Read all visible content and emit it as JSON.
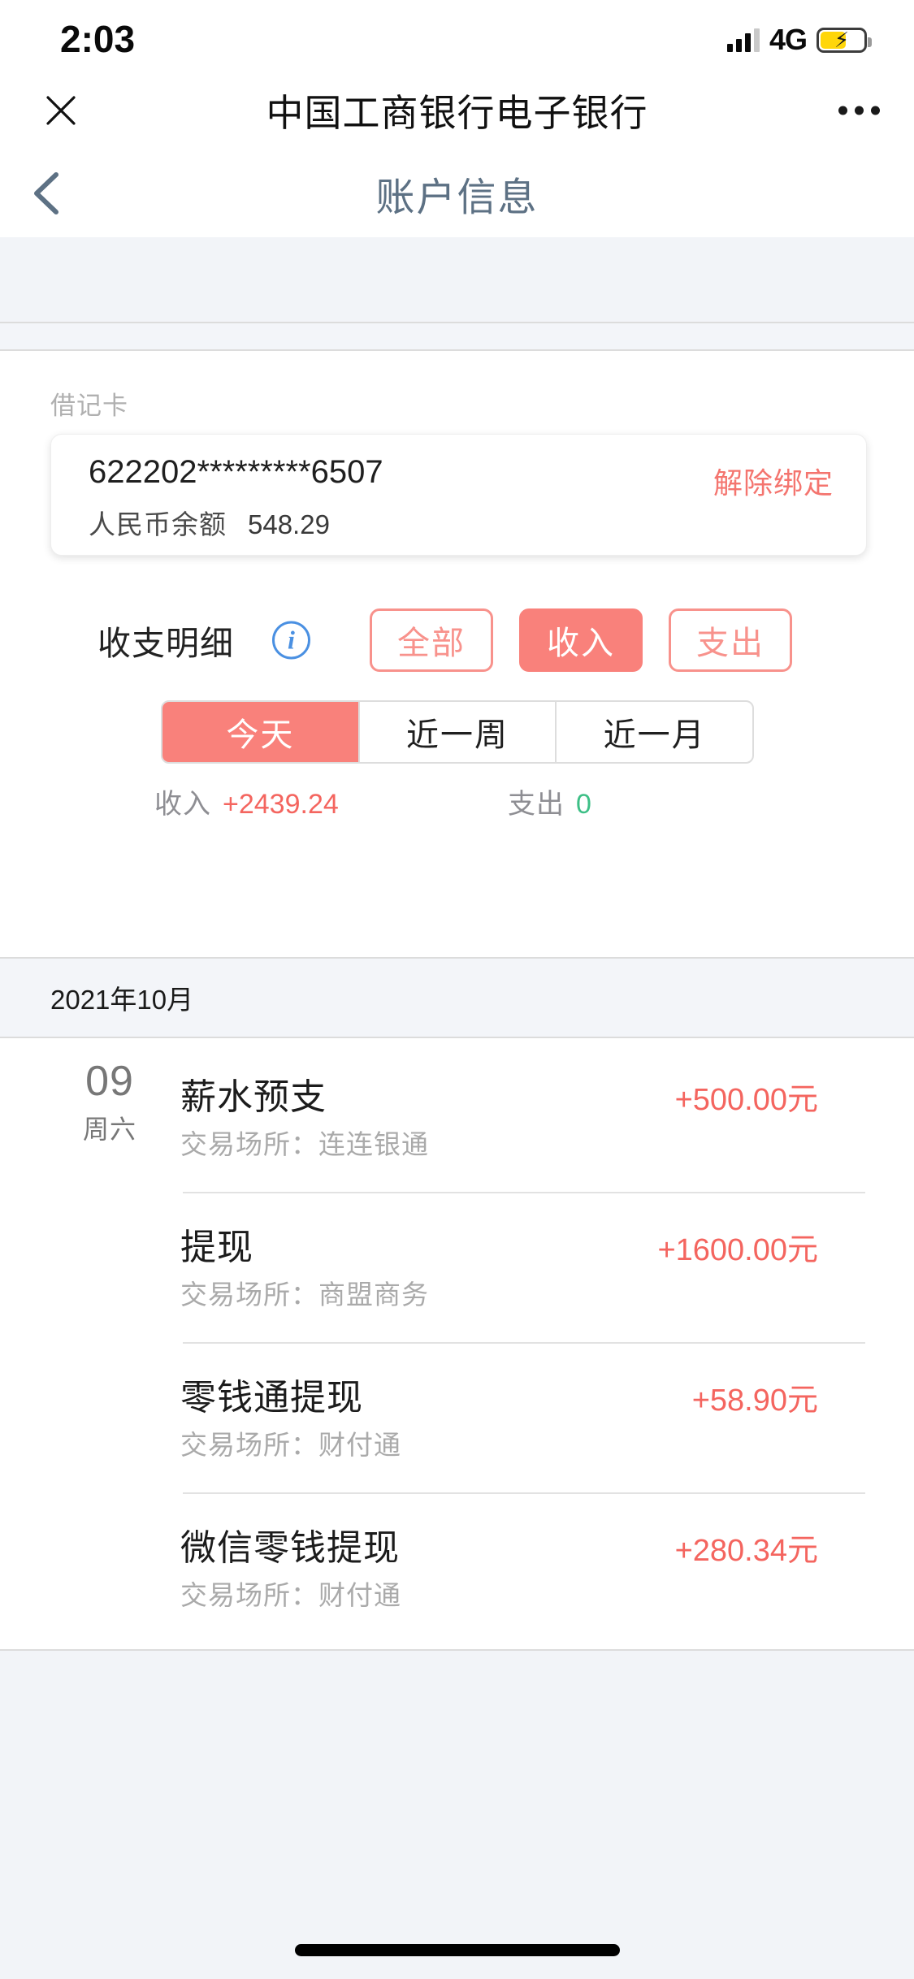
{
  "status_bar": {
    "time": "2:03",
    "network": "4G",
    "signal_icon": "signal-bars-icon",
    "battery_icon": "battery-charging-icon"
  },
  "nav": {
    "close_icon": "close-icon",
    "title": "中国工商银行电子银行",
    "more_icon": "more-horizontal-icon"
  },
  "page_header": {
    "back_icon": "chevron-left-icon",
    "title": "账户信息"
  },
  "account": {
    "section_label": "借记卡",
    "card_number": "622202*********6507",
    "balance_label": "人民币余额",
    "balance_value": "548.29",
    "unbind_label": "解除绑定"
  },
  "filters": {
    "label": "收支明细",
    "info_icon": "info-circle-icon",
    "info_glyph": "i",
    "chips": [
      {
        "label": "全部",
        "active": false
      },
      {
        "label": "收入",
        "active": true
      },
      {
        "label": "支出",
        "active": false
      }
    ]
  },
  "period_tabs": [
    {
      "label": "今天",
      "active": true
    },
    {
      "label": "近一周",
      "active": false
    },
    {
      "label": "近一月",
      "active": false
    }
  ],
  "summary": {
    "income_label": "收入",
    "income_value": "+2439.24",
    "expense_label": "支出",
    "expense_value": "0"
  },
  "month_group": {
    "header": "2021年10月"
  },
  "transactions": [
    {
      "day": "09",
      "weekday": "周六",
      "title": "薪水预支",
      "place": "交易场所：连连银通",
      "amount": "+500.00元"
    },
    {
      "day": "",
      "weekday": "",
      "title": "提现",
      "place": "交易场所：商盟商务",
      "amount": "+1600.00元"
    },
    {
      "day": "",
      "weekday": "",
      "title": "零钱通提现",
      "place": "交易场所：财付通",
      "amount": "+58.90元"
    },
    {
      "day": "",
      "weekday": "",
      "title": "微信零钱提现",
      "place": "交易场所：财付通",
      "amount": "+280.34元"
    }
  ],
  "colors": {
    "accent": "#f9817b",
    "income": "#f4655f",
    "expense": "#3dbf86",
    "header_title": "#5d7184",
    "page_bg": "#f2f4f8"
  }
}
